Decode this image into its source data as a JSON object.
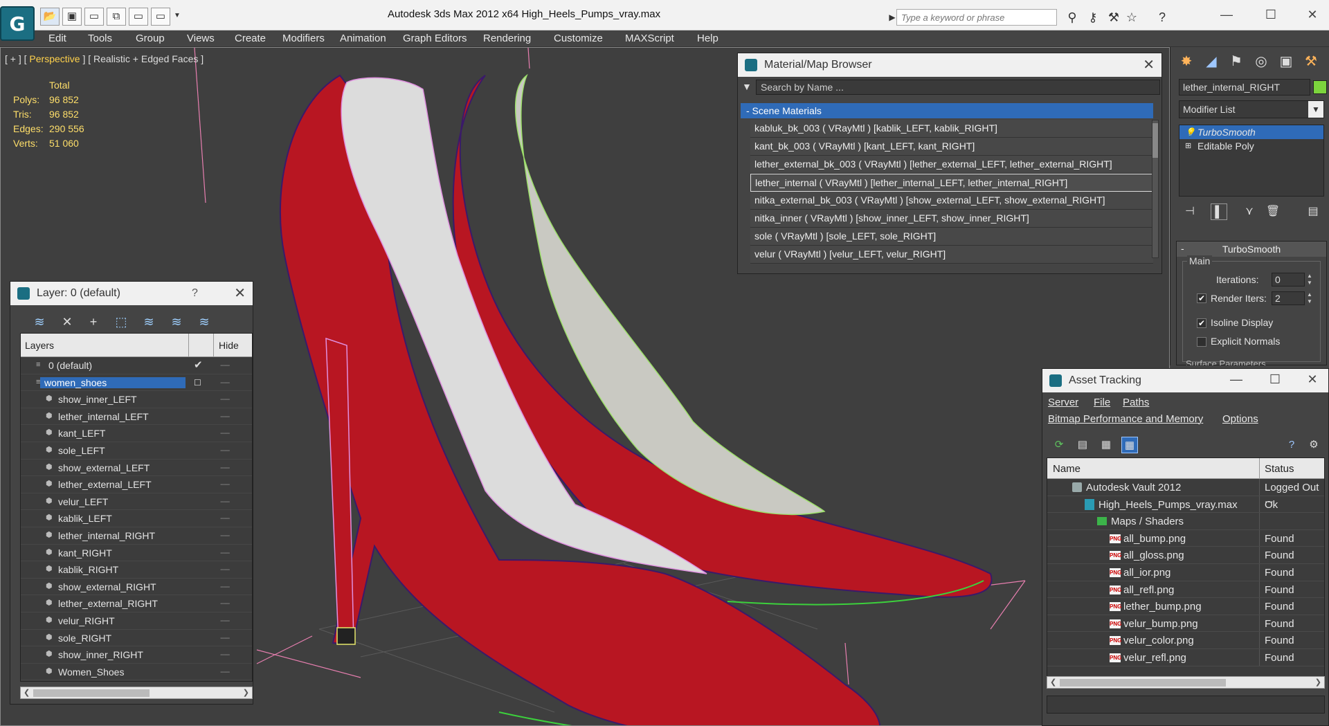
{
  "titlebar": {
    "title": "Autodesk 3ds Max  2012 x64     High_Heels_Pumps_vray.max",
    "search_placeholder": "Type a keyword or phrase"
  },
  "menu": [
    "Edit",
    "Tools",
    "Group",
    "Views",
    "Create",
    "Modifiers",
    "Animation",
    "Graph Editors",
    "Rendering",
    "Customize",
    "MAXScript",
    "Help"
  ],
  "viewport": {
    "label_prefix": "[ + ] [",
    "label_view": " Perspective ",
    "label_suffix": "] [ Realistic + Edged Faces ]",
    "stats_header": "Total",
    "stats": [
      {
        "label": "Polys:",
        "value": "96 852"
      },
      {
        "label": "Tris:",
        "value": "96 852"
      },
      {
        "label": "Edges:",
        "value": "290 556"
      },
      {
        "label": "Verts:",
        "value": "51 060"
      }
    ]
  },
  "material_browser": {
    "title": "Material/Map Browser",
    "search": "Search by Name ...",
    "section": "- Scene Materials",
    "rows": [
      "kabluk_bk_003  ( VRayMtl )  [kablik_LEFT, kablik_RIGHT]",
      "kant_bk_003  ( VRayMtl )  [kant_LEFT, kant_RIGHT]",
      "lether_external_bk_003  ( VRayMtl )  [lether_external_LEFT, lether_external_RIGHT]",
      "lether_internal  ( VRayMtl )  [lether_internal_LEFT, lether_internal_RIGHT]",
      "nitka_external_bk_003  ( VRayMtl )  [show_external_LEFT, show_external_RIGHT]",
      "nitka_inner  ( VRayMtl )  [show_inner_LEFT, show_inner_RIGHT]",
      "sole  ( VRayMtl )  [sole_LEFT, sole_RIGHT]",
      "velur  ( VRayMtl )  [velur_LEFT, velur_RIGHT]"
    ],
    "selected_index": 3
  },
  "layer_panel": {
    "title": "Layer: 0 (default)",
    "help": "?",
    "col_layers": "Layers",
    "col_hide": "Hide",
    "hide_marker": "-----",
    "rows": [
      {
        "name": "0 (default)",
        "level": 0,
        "checked": true
      },
      {
        "name": "women_shoes",
        "level": 0,
        "selected": true
      },
      {
        "name": "show_inner_LEFT",
        "level": 1
      },
      {
        "name": "lether_internal_LEFT",
        "level": 1
      },
      {
        "name": "kant_LEFT",
        "level": 1
      },
      {
        "name": "sole_LEFT",
        "level": 1
      },
      {
        "name": "show_external_LEFT",
        "level": 1
      },
      {
        "name": "lether_external_LEFT",
        "level": 1
      },
      {
        "name": "velur_LEFT",
        "level": 1
      },
      {
        "name": "kablik_LEFT",
        "level": 1
      },
      {
        "name": "lether_internal_RIGHT",
        "level": 1
      },
      {
        "name": "kant_RIGHT",
        "level": 1
      },
      {
        "name": "kablik_RIGHT",
        "level": 1
      },
      {
        "name": "show_external_RIGHT",
        "level": 1
      },
      {
        "name": "lether_external_RIGHT",
        "level": 1
      },
      {
        "name": "velur_RIGHT",
        "level": 1
      },
      {
        "name": "sole_RIGHT",
        "level": 1
      },
      {
        "name": "show_inner_RIGHT",
        "level": 1
      },
      {
        "name": "Women_Shoes",
        "level": 1
      }
    ]
  },
  "command_panel": {
    "object_name": "lether_internal_RIGHT",
    "object_color": "#7cd43d",
    "modifier_list": "Modifier List",
    "stack": [
      "TurboSmooth",
      "Editable Poly"
    ],
    "rollout_title": "TurboSmooth",
    "group_main": "Main",
    "iterations_label": "Iterations:",
    "iterations_value": "0",
    "render_iters_label": "Render Iters:",
    "render_iters_value": "2",
    "render_iters_checked": true,
    "isoline_label": "Isoline Display",
    "isoline_checked": true,
    "explicit_label": "Explicit Normals",
    "explicit_checked": false,
    "surface_label": "Surface Parameters"
  },
  "asset_tracking": {
    "title": "Asset Tracking",
    "menu1": [
      "Server",
      "File",
      "Paths"
    ],
    "menu2": [
      "Bitmap Performance and Memory",
      "Options"
    ],
    "col_name": "Name",
    "col_status": "Status",
    "rows": [
      {
        "name": "Autodesk Vault 2012",
        "status": "Logged Out ...",
        "icon": "vault",
        "indent": 0
      },
      {
        "name": "High_Heels_Pumps_vray.max",
        "status": "Ok",
        "icon": "max",
        "indent": 1
      },
      {
        "name": "Maps / Shaders",
        "status": "",
        "icon": "folder",
        "indent": 2
      },
      {
        "name": "all_bump.png",
        "status": "Found",
        "icon": "png",
        "indent": 3
      },
      {
        "name": "all_gloss.png",
        "status": "Found",
        "icon": "png",
        "indent": 3
      },
      {
        "name": "all_ior.png",
        "status": "Found",
        "icon": "png",
        "indent": 3
      },
      {
        "name": "all_refl.png",
        "status": "Found",
        "icon": "png",
        "indent": 3
      },
      {
        "name": "lether_bump.png",
        "status": "Found",
        "icon": "png",
        "indent": 3
      },
      {
        "name": "velur_bump.png",
        "status": "Found",
        "icon": "png",
        "indent": 3
      },
      {
        "name": "velur_color.png",
        "status": "Found",
        "icon": "png",
        "indent": 3
      },
      {
        "name": "velur_refl.png",
        "status": "Found",
        "icon": "png",
        "indent": 3
      }
    ]
  }
}
